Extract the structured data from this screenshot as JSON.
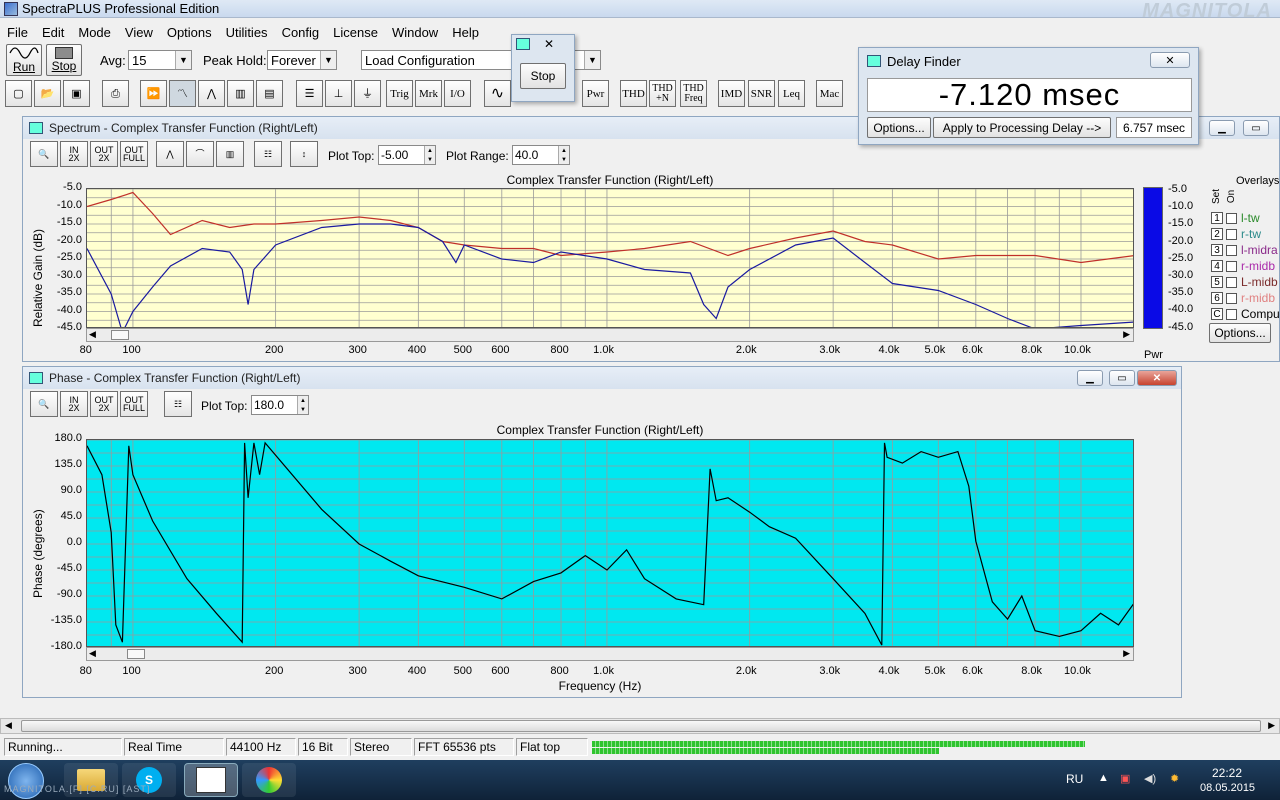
{
  "app": {
    "title": "SpectraPLUS Professional Edition",
    "watermark": "MAGNITOLA"
  },
  "menu": [
    "File",
    "Edit",
    "Mode",
    "View",
    "Options",
    "Utilities",
    "Config",
    "License",
    "Window",
    "Help"
  ],
  "toolbar": {
    "run_label": "Run",
    "stop_label": "Stop",
    "avg_label": "Avg:",
    "avg_value": "15",
    "peak_hold_label": "Peak Hold:",
    "peak_hold_value": "Forever",
    "config_value": "Load Configuration",
    "icons": [
      "Trig",
      "Mrk",
      "I/O",
      "Pwr",
      "THD",
      "THD +N",
      "THD Freq",
      "IMD",
      "SNR",
      "Leq",
      "Mac"
    ]
  },
  "stop_popup": {
    "button": "Stop"
  },
  "delay_finder": {
    "title": "Delay Finder",
    "value": "-7.120 msec",
    "options_label": "Options...",
    "apply_label": "Apply to Processing Delay -->",
    "processing_delay": "6.757 msec"
  },
  "spectrum": {
    "window_title": "Spectrum - Complex Transfer Function (Right/Left)",
    "plot_top_label": "Plot Top:",
    "plot_top_value": "-5.00",
    "plot_range_label": "Plot Range:",
    "plot_range_value": "40.0",
    "pwr_label": "Pwr",
    "overlays_label": "Overlays",
    "set_label": "Set",
    "on_label": "On",
    "overlays": [
      {
        "num": "1",
        "name": "l-tw",
        "color": "#2a8a2a"
      },
      {
        "num": "2",
        "name": "r-tw",
        "color": "#2a8a8a"
      },
      {
        "num": "3",
        "name": "l-midra",
        "color": "#8a2a8a"
      },
      {
        "num": "4",
        "name": "r-midb",
        "color": "#aa2aaa"
      },
      {
        "num": "5",
        "name": "L-midb",
        "color": "#7a2a2a"
      },
      {
        "num": "6",
        "name": "r-midb",
        "color": "#e08080"
      },
      {
        "num": "C",
        "name": "Compu",
        "color": "#000000"
      }
    ],
    "overlay_options": "Options...",
    "bar_ticks": [
      "-5.0",
      "-10.0",
      "-15.0",
      "-20.0",
      "-25.0",
      "-30.0",
      "-35.0",
      "-40.0",
      "-45.0"
    ]
  },
  "phase": {
    "window_title": "Phase - Complex Transfer Function (Right/Left)",
    "plot_top_label": "Plot Top:",
    "plot_top_value": "180.0"
  },
  "chart_data": [
    {
      "type": "line",
      "title": "Complex Transfer Function (Right/Left)",
      "ylabel": "Relative Gain (dB)",
      "xlabel": "",
      "x_scale": "log",
      "xlim": [
        80,
        13000
      ],
      "ylim": [
        -45,
        -5
      ],
      "x_ticks": [
        {
          "v": 80,
          "t": "80"
        },
        {
          "v": 100,
          "t": "100"
        },
        {
          "v": 200,
          "t": "200"
        },
        {
          "v": 300,
          "t": "300"
        },
        {
          "v": 400,
          "t": "400"
        },
        {
          "v": 500,
          "t": "500"
        },
        {
          "v": 600,
          "t": "600"
        },
        {
          "v": 800,
          "t": "800"
        },
        {
          "v": 1000,
          "t": "1.0k"
        },
        {
          "v": 2000,
          "t": "2.0k"
        },
        {
          "v": 3000,
          "t": "3.0k"
        },
        {
          "v": 4000,
          "t": "4.0k"
        },
        {
          "v": 5000,
          "t": "5.0k"
        },
        {
          "v": 6000,
          "t": "6.0k"
        },
        {
          "v": 8000,
          "t": "8.0k"
        },
        {
          "v": 10000,
          "t": "10.0k"
        }
      ],
      "y_ticks": [
        "-5.0",
        "-10.0",
        "-15.0",
        "-20.0",
        "-25.0",
        "-30.0",
        "-35.0",
        "-40.0",
        "-45.0"
      ],
      "background": "#ffffd0",
      "grid": true,
      "series": [
        {
          "color": "#c0302a",
          "x": [
            80,
            90,
            100,
            110,
            120,
            140,
            160,
            180,
            200,
            250,
            300,
            350,
            400,
            450,
            500,
            600,
            700,
            800,
            1000,
            1200,
            1500,
            1800,
            2000,
            2500,
            3000,
            3500,
            4000,
            5000,
            6000,
            8000,
            10000,
            13000
          ],
          "y": [
            -10,
            -8,
            -6,
            -12,
            -18,
            -14,
            -16,
            -15,
            -15,
            -14,
            -13,
            -14,
            -16,
            -20,
            -21,
            -22,
            -22,
            -24,
            -23,
            -22,
            -20,
            -24,
            -22,
            -19,
            -17,
            -20,
            -21,
            -25,
            -24,
            -24,
            -26,
            -24
          ]
        },
        {
          "color": "#1a1aa0",
          "x": [
            80,
            90,
            95,
            100,
            110,
            120,
            140,
            160,
            170,
            175,
            180,
            200,
            250,
            300,
            350,
            400,
            450,
            480,
            500,
            600,
            700,
            800,
            1000,
            1200,
            1500,
            1600,
            1700,
            1800,
            2000,
            2500,
            3000,
            3500,
            4000,
            5000,
            6000,
            7000,
            8000,
            10000,
            13000
          ],
          "y": [
            -22,
            -35,
            -46,
            -40,
            -33,
            -27,
            -22,
            -23,
            -28,
            -38,
            -28,
            -21,
            -16,
            -15,
            -15,
            -16,
            -20,
            -26,
            -21,
            -25,
            -26,
            -23,
            -25,
            -28,
            -29,
            -38,
            -42,
            -33,
            -28,
            -21,
            -19,
            -26,
            -32,
            -34,
            -38,
            -42,
            -45,
            -44,
            -43
          ]
        }
      ]
    },
    {
      "type": "line",
      "title": "Complex Transfer Function (Right/Left)",
      "ylabel": "Phase (degrees)",
      "xlabel": "Frequency (Hz)",
      "x_scale": "log",
      "xlim": [
        80,
        13000
      ],
      "ylim": [
        -180,
        180
      ],
      "x_ticks": [
        {
          "v": 80,
          "t": "80"
        },
        {
          "v": 100,
          "t": "100"
        },
        {
          "v": 200,
          "t": "200"
        },
        {
          "v": 300,
          "t": "300"
        },
        {
          "v": 400,
          "t": "400"
        },
        {
          "v": 500,
          "t": "500"
        },
        {
          "v": 600,
          "t": "600"
        },
        {
          "v": 800,
          "t": "800"
        },
        {
          "v": 1000,
          "t": "1.0k"
        },
        {
          "v": 2000,
          "t": "2.0k"
        },
        {
          "v": 3000,
          "t": "3.0k"
        },
        {
          "v": 4000,
          "t": "4.0k"
        },
        {
          "v": 5000,
          "t": "5.0k"
        },
        {
          "v": 6000,
          "t": "6.0k"
        },
        {
          "v": 8000,
          "t": "8.0k"
        },
        {
          "v": 10000,
          "t": "10.0k"
        }
      ],
      "y_ticks": [
        "180.0",
        "135.0",
        "90.0",
        "45.0",
        "0.0",
        "-45.0",
        "-90.0",
        "-135.0",
        "-180.0"
      ],
      "background": "#00e8f0",
      "grid": true,
      "series": [
        {
          "color": "#000000",
          "x": [
            80,
            86,
            90,
            92,
            95,
            98,
            100,
            110,
            130,
            150,
            170,
            172,
            175,
            180,
            185,
            190,
            250,
            300,
            350,
            400,
            500,
            600,
            700,
            800,
            900,
            1000,
            1100,
            1200,
            1400,
            1600,
            1650,
            1700,
            1800,
            2000,
            2200,
            2500,
            3000,
            3500,
            3800,
            3850,
            3900,
            4200,
            4600,
            5000,
            5500,
            5800,
            6000,
            6500,
            7000,
            7500,
            8000,
            9000,
            10000,
            11000,
            12000,
            13000
          ],
          "y": [
            170,
            120,
            20,
            -140,
            -170,
            170,
            120,
            40,
            -60,
            -120,
            -170,
            175,
            80,
            175,
            120,
            175,
            60,
            0,
            -30,
            -55,
            -75,
            -95,
            -65,
            -50,
            -20,
            -45,
            -10,
            -60,
            -95,
            -105,
            130,
            75,
            80,
            55,
            30,
            10,
            -60,
            -120,
            -175,
            175,
            150,
            140,
            160,
            150,
            160,
            100,
            5,
            -100,
            -130,
            -90,
            -150,
            -160,
            -150,
            -120,
            -140,
            -100
          ]
        }
      ]
    }
  ],
  "status": {
    "state": "Running...",
    "mode": "Real Time",
    "rate": "44100 Hz",
    "bits": "16 Bit",
    "channels": "Stereo",
    "fft": "FFT 65536 pts",
    "window": "Flat top"
  },
  "level_meter": {
    "left": 0.88,
    "right": 0.62
  },
  "taskbar": {
    "lang": "RU",
    "time": "22:22",
    "date": "08.05.2015",
    "footer_watermark": "MAGNITOLA.[F] [C.RU] [AST]"
  }
}
